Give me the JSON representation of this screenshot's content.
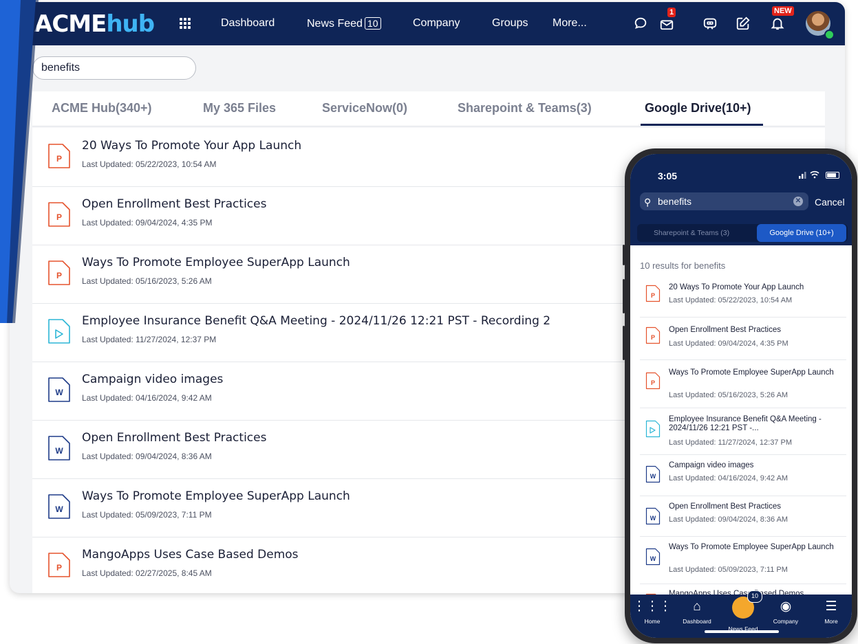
{
  "app": {
    "logo_acme": "ACME",
    "logo_hub": "hub"
  },
  "nav": {
    "items": [
      {
        "label": "Dashboard"
      },
      {
        "label": "News Feed",
        "count": "10"
      },
      {
        "label": "Company"
      },
      {
        "label": "Groups"
      },
      {
        "label": "More..."
      }
    ],
    "inbox_badge": "1",
    "notif_badge": "NEW"
  },
  "search": {
    "value": "benefits"
  },
  "tabs": [
    {
      "label": "ACME Hub(340+)"
    },
    {
      "label": "My 365 Files"
    },
    {
      "label": "ServiceNow(0)"
    },
    {
      "label": "Sharepoint & Teams(3)"
    },
    {
      "label": "Google Drive(10+)",
      "active": true
    }
  ],
  "results": [
    {
      "type": "P",
      "title": "20 Ways To Promote Your App Launch",
      "meta": "Last Updated: 05/22/2023, 10:54 AM"
    },
    {
      "type": "P",
      "title": "Open Enrollment Best Practices",
      "meta": "Last Updated: 09/04/2024, 4:35 PM"
    },
    {
      "type": "P",
      "title": "Ways To Promote Employee SuperApp Launch",
      "meta": "Last Updated: 05/16/2023, 5:26 AM"
    },
    {
      "type": "video",
      "title": "Employee Insurance Benefit Q&A Meeting - 2024/11/26 12:21 PST - Recording 2",
      "meta": "Last Updated: 11/27/2024, 12:37 PM"
    },
    {
      "type": "W",
      "title": "Campaign video images",
      "meta": "Last Updated: 04/16/2024, 9:42 AM"
    },
    {
      "type": "W",
      "title": "Open Enrollment Best Practices",
      "meta": "Last Updated: 09/04/2024, 8:36 AM"
    },
    {
      "type": "W",
      "title": "Ways To Promote Employee SuperApp Launch",
      "meta": "Last Updated: 05/09/2023, 7:11 PM"
    },
    {
      "type": "P",
      "title": "MangoApps Uses Case Based Demos",
      "meta": "Last Updated: 02/27/2025, 8:45 AM"
    }
  ],
  "phone": {
    "time": "3:05",
    "search_value": "benefits",
    "cancel": "Cancel",
    "tab1": "Sharepoint & Teams (3)",
    "tab2": "Google Drive (10+)",
    "count_text": "10 results for benefits",
    "results": [
      {
        "type": "P",
        "title": "20 Ways To Promote Your App Launch",
        "meta": "Last Updated: 05/22/2023, 10:54 AM"
      },
      {
        "type": "P",
        "title": "Open Enrollment Best Practices",
        "meta": "Last Updated: 09/04/2024, 4:35 PM"
      },
      {
        "type": "P",
        "title": "Ways To Promote Employee SuperApp Launch",
        "meta": "Last Updated: 05/16/2023, 5:26 AM"
      },
      {
        "type": "video",
        "title": "Employee Insurance Benefit  Q&A Meeting - 2024/11/26 12:21 PST -...",
        "meta": "Last Updated: 11/27/2024, 12:37 PM"
      },
      {
        "type": "W",
        "title": "Campaign video images",
        "meta": "Last Updated: 04/16/2024, 9:42 AM"
      },
      {
        "type": "W",
        "title": "Open Enrollment Best Practices",
        "meta": "Last Updated: 09/04/2024, 8:36 AM"
      },
      {
        "type": "W",
        "title": "Ways To Promote Employee SuperApp Launch",
        "meta": "Last Updated: 05/09/2023, 7:11 PM"
      },
      {
        "type": "P",
        "title": "MangoApps Uses Case Based Demos",
        "meta": ""
      }
    ],
    "bottom_nav": [
      {
        "label": "Home"
      },
      {
        "label": "Dashboard"
      },
      {
        "label": "News Feed",
        "badge": "10"
      },
      {
        "label": "Company"
      },
      {
        "label": "More"
      }
    ]
  },
  "colors": {
    "nav_bg": "#0f2557",
    "accent": "#3fb4f4",
    "ppt": "#e5532d",
    "word": "#1f3c88",
    "video": "#2bb6d6"
  }
}
